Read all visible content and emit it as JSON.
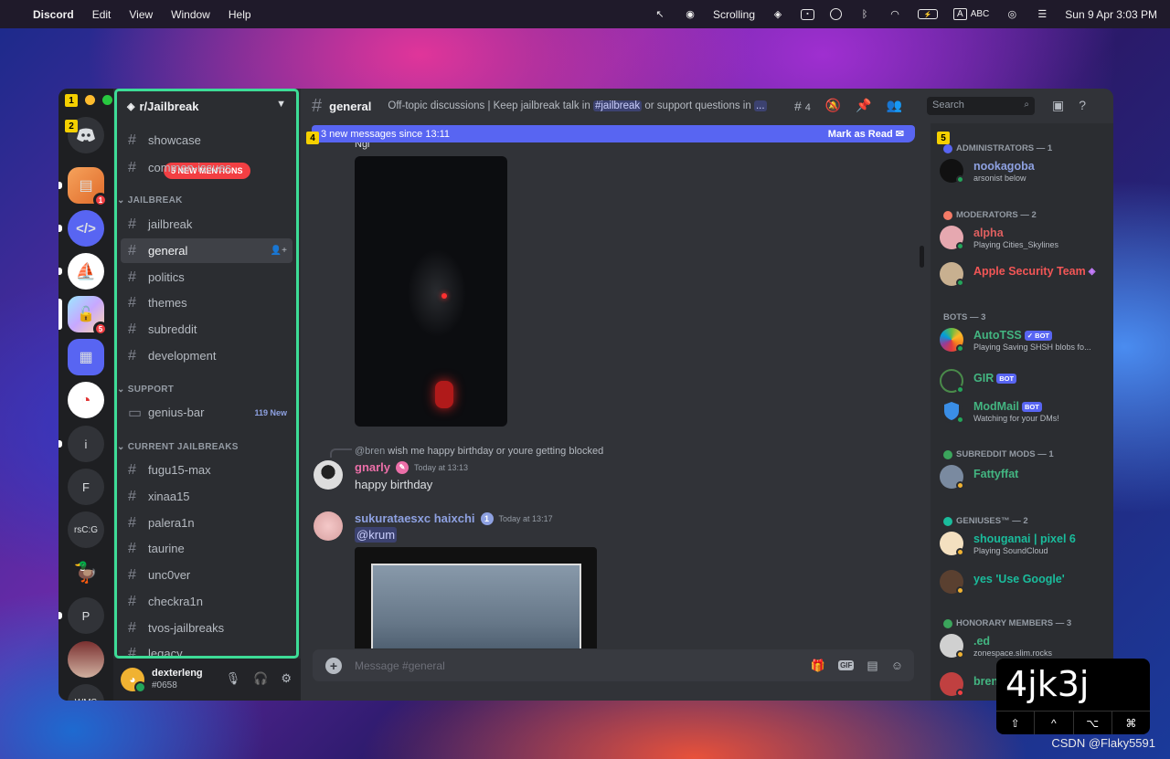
{
  "menubar": {
    "app": "Discord",
    "menus": [
      "Edit",
      "View",
      "Window",
      "Help"
    ],
    "scrolling": "Scrolling",
    "input": "ABC",
    "input_key": "A",
    "datetime": "Sun 9 Apr  3:03 PM"
  },
  "tags": {
    "t1": "1",
    "t2": "2",
    "t4": "4",
    "t5": "5"
  },
  "guilds": {
    "badge1": "1",
    "badge2": "5",
    "letters": [
      "i",
      "F",
      "rsC:G",
      "P"
    ],
    "bottom": "WMS"
  },
  "server": {
    "name": "r/Jailbreak",
    "mentions": "5 NEW MENTIONS",
    "top_channels": [
      "showcase",
      "common-issues"
    ],
    "cat_jailbreak": "JAILBREAK",
    "jb_channels": [
      "jailbreak",
      "general",
      "politics",
      "themes",
      "subreddit",
      "development"
    ],
    "cat_support": "SUPPORT",
    "support_channel": "genius-bar",
    "support_new": "119 New",
    "cat_current": "CURRENT JAILBREAKS",
    "current_channels": [
      "fugu15-max",
      "xinaa15",
      "palera1n",
      "taurine",
      "unc0ver",
      "checkra1n",
      "tvos-jailbreaks",
      "legacy"
    ]
  },
  "user": {
    "name": "dexterleng",
    "tag": "#0658"
  },
  "channel": {
    "name": "general",
    "topic_a": "Off-topic discussions | Keep jailbreak talk in ",
    "topic_ch": "#jailbreak",
    "topic_b": " or support questions in ",
    "topic_more": "...",
    "threads": "4",
    "search": "Search"
  },
  "banner": {
    "text": "3 new messages since 13:11",
    "mark": "Mark as Read"
  },
  "messages": {
    "ngl": "Ngl",
    "reply_user": "@bren",
    "reply_text": "wish me happy birthday or youre getting blocked",
    "m1_author": "gnarly",
    "m1_time": "Today at 13:13",
    "m1_text": "happy birthday",
    "m2_author": "sukurataesxc haixchi",
    "m2_time": "Today at 13:17",
    "m2_mention": "@krum"
  },
  "composer": {
    "placeholder": "Message #general",
    "gif": "GIF"
  },
  "members": {
    "admins": "ADMINISTRATORS — 1",
    "admin1": "nookagoba",
    "admin1_sub": "arsonist below",
    "mods": "MODERATORS — 2",
    "mod1": "alpha",
    "mod1_sub": "Playing Cities_Skylines",
    "mod2": "Apple Security Team",
    "bots": "BOTS — 3",
    "bot1": "AutoTSS",
    "bot1_sub": "Playing Saving SHSH blobs fo...",
    "bot2": "GIR",
    "bot3": "ModMail",
    "bot3_sub": "Watching for your DMs!",
    "bot_label": "BOT",
    "bot_label_v": "✓ BOT",
    "submods": "SUBREDDIT MODS — 1",
    "submod1": "Fattyffat",
    "geniuses": "GENIUSES™ — 2",
    "gen1": "shouganai | pixel 6",
    "gen1_sub": "Playing SoundCloud",
    "gen2": "yes 'Use Google'",
    "honorary": "HONORARY MEMBERS — 3",
    "hon1": ".ed",
    "hon1_sub": "zonespace.slim.rocks",
    "hon2": "bren"
  },
  "keyoverlay": {
    "keys": "4jk3j",
    "mods": [
      "⇧",
      "^",
      "⌥",
      "⌘"
    ]
  },
  "watermark": "CSDN @Flaky5591",
  "colors": {
    "accent": "#5865f2",
    "highlight": "#3ddc97",
    "tag": "#f5d000",
    "admin": "#8ea1e1",
    "mod": "#f47b67",
    "bot": "#43b581",
    "gnarly": "#eb6fa8",
    "alpha": "#e06060",
    "apple": "#f35656"
  }
}
